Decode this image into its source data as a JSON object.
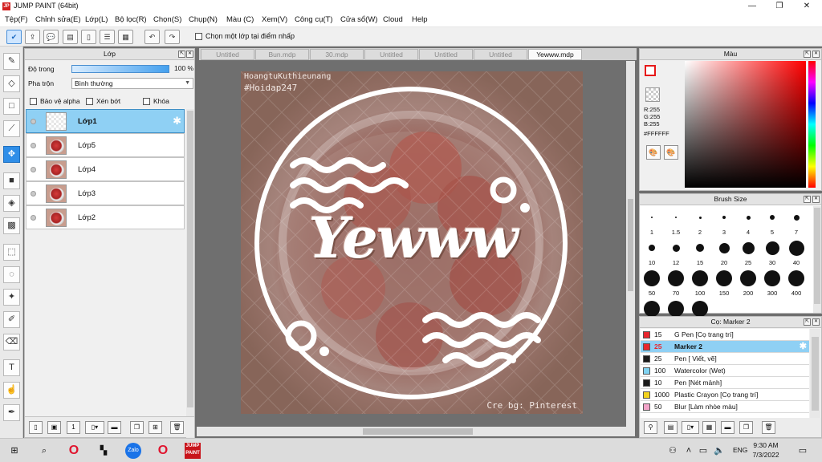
{
  "window": {
    "title": "JUMP PAINT (64bit)",
    "app_icon_text": "JP",
    "minimize_glyph": "—",
    "maximize_glyph": "❐",
    "close_glyph": "✕"
  },
  "menu": [
    "Tệp(F)",
    "Chỉnh sửa(E)",
    "Lớp(L)",
    "Bộ lọc(R)",
    "Chọn(S)",
    "Chụp(N)",
    "Màu (C)",
    "Xem(V)",
    "Công cụ(T)",
    "Cửa sổ(W)",
    "Cloud",
    "Help"
  ],
  "toolbar": {
    "sample_layer_label": "Chọn một lớp tại điểm nhấp",
    "sample_layer_checked": false
  },
  "layer_panel": {
    "title": "Lớp",
    "opacity_label": "Độ trong",
    "opacity_value": "100 %",
    "opacity_fraction": 1.0,
    "blend_label": "Pha trộn",
    "blend_value": "Bình thường",
    "protect_alpha_label": "Bảo vệ alpha",
    "clipping_label": "Xén bớt",
    "lock_label": "Khóa",
    "layers": [
      {
        "name": "Lớp1",
        "selected": true,
        "empty": true
      },
      {
        "name": "Lớp5",
        "selected": false,
        "empty": false
      },
      {
        "name": "Lớp4",
        "selected": false,
        "empty": false
      },
      {
        "name": "Lớp3",
        "selected": false,
        "empty": false
      },
      {
        "name": "Lớp2",
        "selected": false,
        "empty": false
      }
    ]
  },
  "tabs": [
    {
      "label": "Untitled",
      "active": false
    },
    {
      "label": "Bun.mdp",
      "active": false
    },
    {
      "label": "30.mdp",
      "active": false
    },
    {
      "label": "Untitled",
      "active": false
    },
    {
      "label": "Untitled",
      "active": false
    },
    {
      "label": "Untitled",
      "active": false
    },
    {
      "label": "Yewww.mdp",
      "active": true
    }
  ],
  "artwork": {
    "watermark_top_1": "HoangtuKuthieunang",
    "watermark_top_2": "#Hoidap247",
    "main_text": "Yewww",
    "credit": "Cre bg: Pinterest"
  },
  "color_panel": {
    "title": "Màu",
    "r": "R:255",
    "g": "G:255",
    "b": "B:255",
    "hex": "#FFFFFF",
    "foreground": "#FFFFFF",
    "accent_border": "#E61919"
  },
  "brush_panel": {
    "title": "Brush Size",
    "sizes": [
      "1",
      "1.5",
      "2",
      "3",
      "4",
      "5",
      "7",
      "10",
      "12",
      "15",
      "20",
      "25",
      "30",
      "40",
      "50",
      "70",
      "100",
      "150",
      "200",
      "300",
      "400"
    ]
  },
  "tool_panel": {
    "title": "Cọ: Marker 2",
    "tools": [
      {
        "size": "15",
        "name": "G Pen [Cọ trang trí]",
        "color": "#E8262E",
        "selected": false
      },
      {
        "size": "25",
        "name": "Marker 2",
        "color": "#E8262E",
        "selected": true
      },
      {
        "size": "25",
        "name": "Pen [ Viết, vẽ]",
        "color": "#1A1A1A",
        "selected": false
      },
      {
        "size": "100",
        "name": "Watercolor (Wet)",
        "color": "#7FD3F2",
        "selected": false
      },
      {
        "size": "10",
        "name": "Pen [Nét mảnh]",
        "color": "#1A1A1A",
        "selected": false
      },
      {
        "size": "1000",
        "name": "Plastic Crayon [Cọ trang trí]",
        "color": "#F2D21E",
        "selected": false
      },
      {
        "size": "50",
        "name": "Blur [Làm nhòe màu]",
        "color": "#F2A3C8",
        "selected": false
      }
    ]
  },
  "taskbar": {
    "time": "9:30 AM",
    "date": "7/3/2022",
    "language": "ENG"
  }
}
